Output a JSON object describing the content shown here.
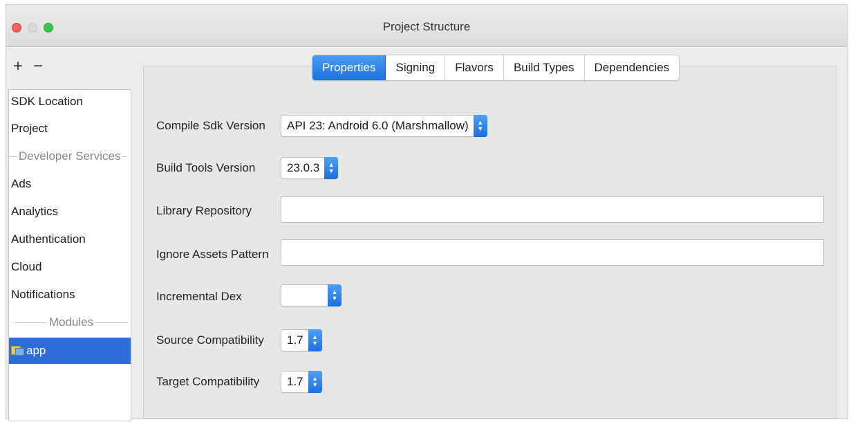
{
  "window": {
    "title": "Project Structure"
  },
  "toolbar": {
    "add_label": "+",
    "remove_label": "−"
  },
  "sidebar": {
    "items": [
      {
        "label": "SDK Location"
      },
      {
        "label": "Project"
      }
    ],
    "developer_services_header": "Developer Services",
    "services": [
      {
        "label": "Ads"
      },
      {
        "label": "Analytics"
      },
      {
        "label": "Authentication"
      },
      {
        "label": "Cloud"
      },
      {
        "label": "Notifications"
      }
    ],
    "modules_header": "Modules",
    "modules": [
      {
        "label": "app",
        "selected": true
      }
    ]
  },
  "tabs": [
    {
      "label": "Properties",
      "active": true
    },
    {
      "label": "Signing",
      "active": false
    },
    {
      "label": "Flavors",
      "active": false
    },
    {
      "label": "Build Types",
      "active": false
    },
    {
      "label": "Dependencies",
      "active": false
    }
  ],
  "form": {
    "compile_sdk": {
      "label": "Compile Sdk Version",
      "value": "API 23: Android 6.0 (Marshmallow)"
    },
    "build_tools": {
      "label": "Build Tools Version",
      "value": "23.0.3"
    },
    "library_repository": {
      "label": "Library Repository",
      "value": ""
    },
    "ignore_assets": {
      "label": "Ignore Assets Pattern",
      "value": ""
    },
    "incremental_dex": {
      "label": "Incremental Dex",
      "value": ""
    },
    "source_compat": {
      "label": "Source Compatibility",
      "value": "1.7"
    },
    "target_compat": {
      "label": "Target Compatibility",
      "value": "1.7"
    }
  },
  "colors": {
    "accent": "#2f6cd8",
    "close": "#fc605c",
    "maximize": "#34c84a"
  }
}
